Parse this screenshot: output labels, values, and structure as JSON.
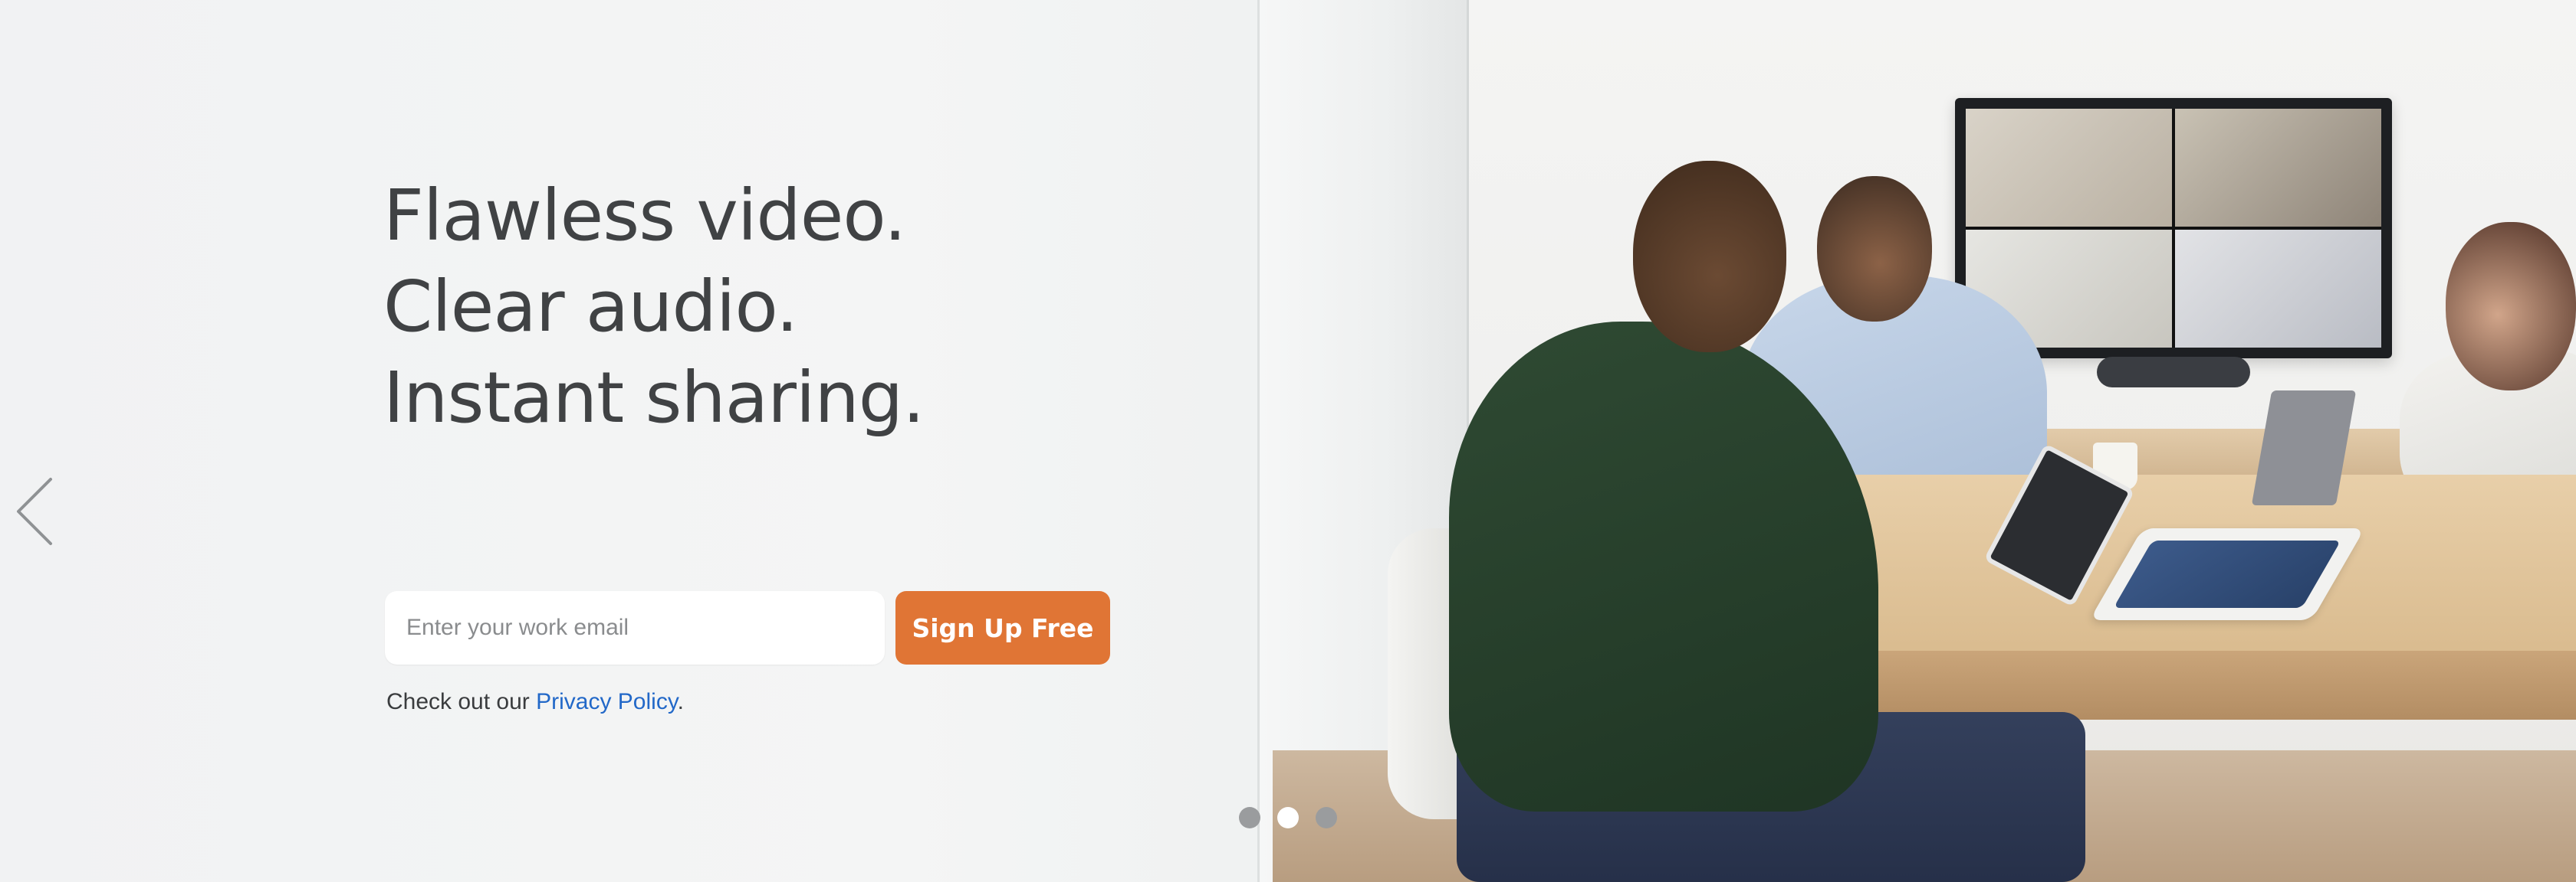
{
  "hero": {
    "headline_lines": [
      "Flawless video.",
      "Clear audio.",
      "Instant sharing."
    ],
    "image_description_icon": "meeting-room-photo"
  },
  "signup": {
    "email_placeholder": "Enter your work email",
    "email_value": "",
    "button_label": "Sign Up Free",
    "accent_color": "#e07535"
  },
  "privacy": {
    "prefix": "Check out our ",
    "link_text": "Privacy Policy",
    "suffix": ".",
    "link_color": "#2268c8"
  },
  "carousel": {
    "prev_icon": "chevron-left-icon",
    "slides": 3,
    "active_slide": 2
  }
}
